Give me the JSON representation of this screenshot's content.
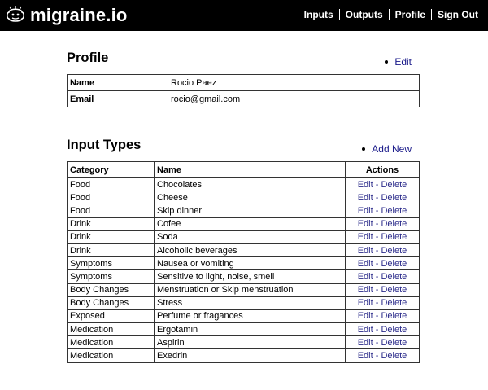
{
  "header": {
    "brand": "migraine.io",
    "nav": [
      {
        "label": "Inputs"
      },
      {
        "label": "Outputs"
      },
      {
        "label": "Profile"
      },
      {
        "label": "Sign Out"
      }
    ]
  },
  "profile": {
    "title": "Profile",
    "edit_label": "Edit",
    "rows": [
      {
        "label": "Name",
        "value": "Rocio Paez"
      },
      {
        "label": "Email",
        "value": "rocio@gmail.com"
      }
    ]
  },
  "input_types": {
    "title": "Input Types",
    "add_label": "Add New",
    "columns": {
      "category": "Category",
      "name": "Name",
      "actions": "Actions"
    },
    "edit_label": "Edit",
    "separator": " - ",
    "delete_label": "Delete",
    "rows": [
      {
        "category": "Food",
        "name": "Chocolates"
      },
      {
        "category": "Food",
        "name": "Cheese"
      },
      {
        "category": "Food",
        "name": "Skip dinner"
      },
      {
        "category": "Drink",
        "name": "Cofee"
      },
      {
        "category": "Drink",
        "name": "Soda"
      },
      {
        "category": "Drink",
        "name": "Alcoholic beverages"
      },
      {
        "category": "Symptoms",
        "name": "Nausea or vomiting"
      },
      {
        "category": "Symptoms",
        "name": "Sensitive to light, noise, smell"
      },
      {
        "category": "Body Changes",
        "name": "Menstruation or Skip menstruation"
      },
      {
        "category": "Body Changes",
        "name": "Stress"
      },
      {
        "category": "Exposed",
        "name": "Perfume or fragances"
      },
      {
        "category": "Medication",
        "name": "Ergotamin"
      },
      {
        "category": "Medication",
        "name": "Aspirin"
      },
      {
        "category": "Medication",
        "name": "Exedrin"
      }
    ]
  },
  "icons": {
    "logo": "brain-face-logo-icon",
    "bullet": "bullet-icon"
  }
}
